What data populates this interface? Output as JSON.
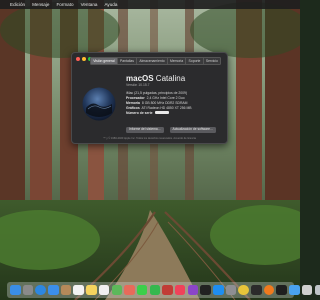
{
  "menubar": {
    "items": [
      "Edición",
      "Mensaje",
      "Formato",
      "Ventana",
      "Ayuda"
    ]
  },
  "window": {
    "tabs": [
      "Visión general",
      "Pantallas",
      "Almacenamiento",
      "Memoria",
      "Soporte",
      "Servicio"
    ],
    "os_name_bold": "macOS",
    "os_name_rest": " Catalina",
    "version": "Versión 10.15.7",
    "specs": [
      {
        "key": "",
        "value": "iMac (21,5 pulgadas, principios de 2009)"
      },
      {
        "key": "Procesador",
        "value": "2,4 GHz Intel Core 2 Duo"
      },
      {
        "key": "Memoria",
        "value": "8 GB 800 MHz DDR2 SDRAM"
      },
      {
        "key": "Gráficos",
        "value": "ATI Radeon HD 4850 XT 256 MB"
      },
      {
        "key": "Número de serie",
        "value": ""
      }
    ],
    "buttons": {
      "report": "Informe del sistema...",
      "update": "Actualización de software..."
    },
    "footer": "™ y © 1983-2020 Apple Inc. Todos los derechos reservados. Acuerdo de licencia"
  },
  "dock": {
    "icons": [
      "finder-icon",
      "launchpad-icon",
      "safari-icon",
      "mail-icon",
      "contacts-icon",
      "calendar-icon",
      "notes-icon",
      "reminders-icon",
      "maps-icon",
      "photos-icon",
      "messages-icon",
      "facetime-icon",
      "photo-booth-icon",
      "music-icon",
      "podcasts-icon",
      "tv-icon",
      "app-store-icon",
      "system-preferences-icon",
      "chrome-icon",
      "terminal-icon",
      "firefox-icon",
      "activity-monitor-icon",
      "finder-folder-icon",
      "generic-app-icon",
      "trash-icon"
    ],
    "colors": [
      "#3a8ee6",
      "#8a8a8a",
      "#2d87e0",
      "#3b8eea",
      "#b5895a",
      "#f2f2f2",
      "#f4d35e",
      "#f0f0f0",
      "#5db85a",
      "#e86a5a",
      "#3bcf4a",
      "#35b84e",
      "#c13c36",
      "#f0425a",
      "#8b45c9",
      "#222222",
      "#1e8ef0",
      "#8e8e93",
      "#e7c43a",
      "#2b2b2b",
      "#f07a1e",
      "#1f1f1f",
      "#4aa3f0",
      "#cfcfcf",
      "#bfc4c8"
    ]
  }
}
